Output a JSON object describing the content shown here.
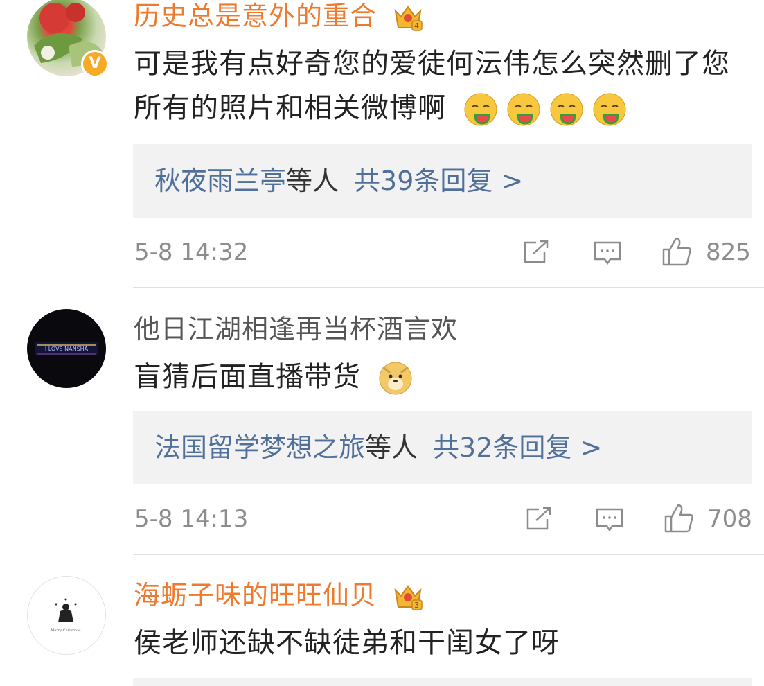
{
  "comments": [
    {
      "username": "历史总是意外的重合",
      "verified_mark": "V",
      "badge_level": "4",
      "text": "可是我有点好奇您的爱徒何沄伟怎么突然删了您所有的照片和相关微博啊",
      "emoji_icons": [
        "watermelon-face-icon",
        "watermelon-face-icon",
        "watermelon-face-icon",
        "watermelon-face-icon"
      ],
      "replies": {
        "users": "秋夜雨兰亭",
        "suffix": "等人",
        "count_text": "共39条回复 >"
      },
      "time": "5-8 14:32",
      "likes": "825"
    },
    {
      "username": "他日江湖相逢再当杯酒言欢",
      "avatar_text": "I LOVE NANSHA",
      "text": "盲猜后面直播带货",
      "emoji_icons": [
        "doge-icon"
      ],
      "replies": {
        "users": "法国留学梦想之旅",
        "suffix": "等人",
        "count_text": "共32条回复 >"
      },
      "time": "5-8 14:13",
      "likes": "708"
    },
    {
      "username": "海蛎子味的旺旺仙贝",
      "badge_level": "3",
      "avatar_text": "Merry Christmas",
      "text": "侯老师还缺不缺徒弟和干闺女了呀"
    }
  ],
  "colors": {
    "vip_name": "#ee7a2e",
    "reply_link": "#50709a",
    "meta": "#8c8c8c",
    "crown": "#f5b731"
  }
}
